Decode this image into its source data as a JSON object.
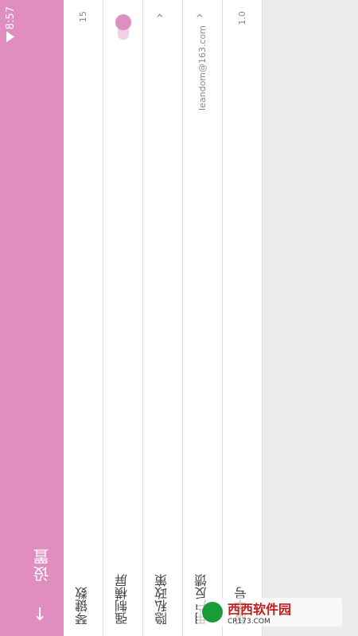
{
  "status": {
    "time": "8:57"
  },
  "header": {
    "title": "设置"
  },
  "settings": [
    {
      "label": "琴键数",
      "value": "15"
    },
    {
      "label": "强制横屏",
      "toggle": true
    },
    {
      "label": "隐私政策"
    },
    {
      "label": "用户反馈",
      "value": "leandom@163.com"
    },
    {
      "label": "版本号",
      "value": "1.0"
    }
  ],
  "watermark": {
    "brand": "西西软件园",
    "site": "CR173.COM"
  },
  "colors": {
    "accent": "#e08dc0"
  }
}
